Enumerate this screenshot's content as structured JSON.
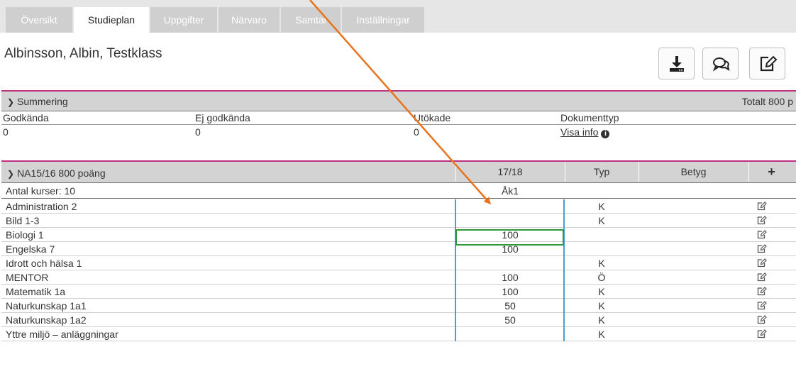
{
  "tabs": [
    {
      "label": "Översikt",
      "active": false
    },
    {
      "label": "Studieplan",
      "active": true
    },
    {
      "label": "Uppgifter",
      "active": false
    },
    {
      "label": "Närvaro",
      "active": false
    },
    {
      "label": "Samtal",
      "active": false
    },
    {
      "label": "Inställningar",
      "active": false
    }
  ],
  "student": {
    "name": "Albinsson, Albin, Testklass"
  },
  "toolbar": {
    "icons": [
      "download-icon",
      "chat-icon",
      "edit-icon"
    ]
  },
  "summary": {
    "title": "Summering",
    "total": "Totalt 800 p",
    "headers": {
      "approved": "Godkända",
      "not_approved": "Ej godkända",
      "extended": "Utökade",
      "doc_type": "Dokumenttyp"
    },
    "values": {
      "approved": "0",
      "not_approved": "0",
      "extended": "0",
      "doc_link": "Visa info"
    }
  },
  "plan": {
    "title": "NA15/16 800 poäng",
    "col_year": "17/18",
    "col_type": "Typ",
    "col_grade": "Betyg",
    "add_symbol": "+",
    "course_count": "Antal kurser: 10",
    "year_label": "Åk1",
    "courses": [
      {
        "name": "Administration 2",
        "points": "",
        "type": "K"
      },
      {
        "name": "Bild 1-3",
        "points": "",
        "type": "K"
      },
      {
        "name": "Biologi 1",
        "points": "100",
        "type": ""
      },
      {
        "name": "Engelska 7",
        "points": "100",
        "type": ""
      },
      {
        "name": "Idrott och hälsa 1",
        "points": "",
        "type": "K"
      },
      {
        "name": "MENTOR",
        "points": "100",
        "type": "Ö"
      },
      {
        "name": "Matematik 1a",
        "points": "100",
        "type": "K"
      },
      {
        "name": "Naturkunskap 1a1",
        "points": "50",
        "type": "K"
      },
      {
        "name": "Naturkunskap 1a2",
        "points": "50",
        "type": "K"
      },
      {
        "name": "Yttre miljö – anläggningar",
        "points": "",
        "type": "K"
      }
    ]
  },
  "colors": {
    "accent": "#c0307f",
    "arrow": "#e8731c",
    "highlight": "#2e9b3a",
    "column_line": "#4a9fd8"
  }
}
